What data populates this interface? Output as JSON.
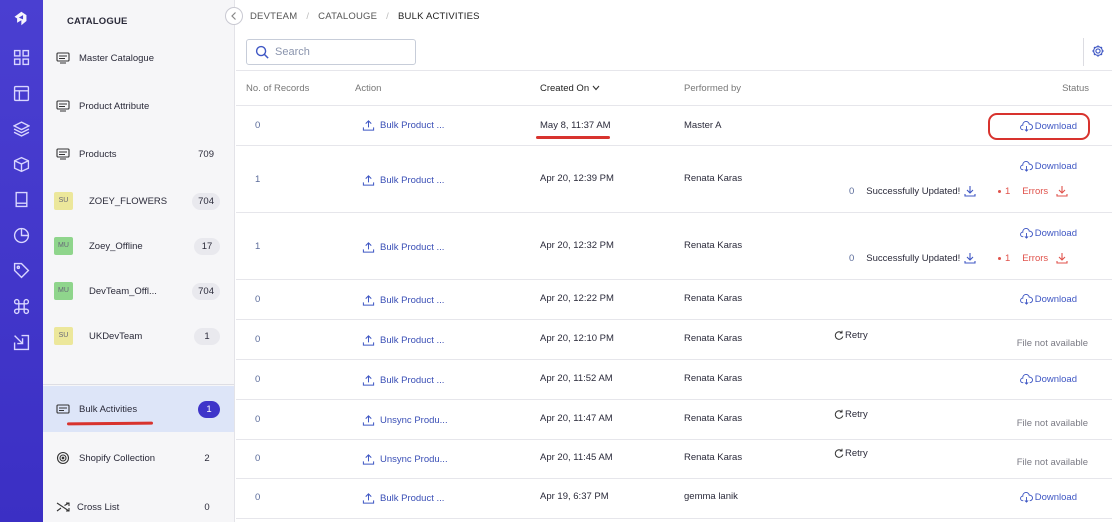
{
  "sidebar": {
    "title": "CATALOGUE",
    "items": [
      {
        "label": "Master Catalogue"
      },
      {
        "label": "Product Attribute"
      },
      {
        "label": "Products",
        "count": "709"
      },
      {
        "label": "ZOEY_FLOWERS",
        "count": "704",
        "avatar": "SU"
      },
      {
        "label": "Zoey_Offline",
        "count": "17",
        "avatar": "MU"
      },
      {
        "label": "DevTeam_Offl...",
        "count": "704",
        "avatar": "MU"
      },
      {
        "label": "UKDevTeam",
        "count": "1",
        "avatar": "SU"
      },
      {
        "label": "Bulk Activities",
        "count": "1"
      },
      {
        "label": "Shopify Collection",
        "count": "2"
      },
      {
        "label": "Cross List",
        "count": "0"
      }
    ]
  },
  "breadcrumb": [
    "DEVTEAM",
    "CATALOUGE",
    "BULK ACTIVITIES"
  ],
  "search": {
    "placeholder": "Search"
  },
  "table": {
    "headers": [
      "No. of Records",
      "Action",
      "Created On",
      "Performed by",
      "Status"
    ],
    "rows": [
      {
        "records": "0",
        "action": "Bulk Product ...",
        "created": "May 8, 11:37 AM",
        "by": "Master A",
        "status": "Download"
      },
      {
        "records": "1",
        "action": "Bulk Product ...",
        "created": "Apr 20, 12:39 PM",
        "by": "Renata Karas",
        "status": "Download",
        "success_count": "0",
        "success_label": "Successfully Updated!",
        "error_count": "1",
        "error_label": "Errors"
      },
      {
        "records": "1",
        "action": "Bulk Product ...",
        "created": "Apr 20, 12:32 PM",
        "by": "Renata Karas",
        "status": "Download",
        "success_count": "0",
        "success_label": "Successfully Updated!",
        "error_count": "1",
        "error_label": "Errors"
      },
      {
        "records": "0",
        "action": "Bulk Product ...",
        "created": "Apr 20, 12:22 PM",
        "by": "Renata Karas",
        "status": "Download"
      },
      {
        "records": "0",
        "action": "Bulk Product ...",
        "created": "Apr 20, 12:10 PM",
        "by": "Renata Karas",
        "retry": "Retry",
        "status": "File not available"
      },
      {
        "records": "0",
        "action": "Bulk Product ...",
        "created": "Apr 20, 11:52 AM",
        "by": "Renata Karas",
        "status": "Download"
      },
      {
        "records": "0",
        "action": "Unsync Produ...",
        "created": "Apr 20, 11:47 AM",
        "by": "Renata Karas",
        "retry": "Retry",
        "status": "File not available"
      },
      {
        "records": "0",
        "action": "Unsync Produ...",
        "created": "Apr 20, 11:45 AM",
        "by": "Renata Karas",
        "retry": "Retry",
        "status": "File not available"
      },
      {
        "records": "0",
        "action": "Bulk Product ...",
        "created": "Apr 19, 6:37 PM",
        "by": "gemma lanik",
        "status": "Download"
      }
    ]
  },
  "colors": {
    "brand": "#3f35c9",
    "link": "#3f57c4",
    "error": "#e0524b",
    "annotation": "#d8332e"
  }
}
